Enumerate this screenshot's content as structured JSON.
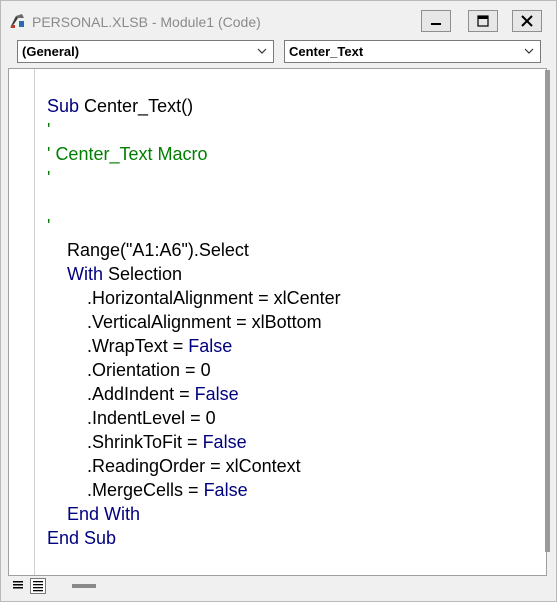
{
  "window": {
    "title": "PERSONAL.XLSB - Module1 (Code)",
    "icons": {
      "app": "vba-module-icon",
      "minimize": "minimize-icon",
      "maximize": "maximize-icon",
      "close": "close-icon"
    }
  },
  "object_combo": {
    "value": "(General)"
  },
  "procedure_combo": {
    "value": "Center_Text"
  },
  "code": {
    "keyword_color": "#00007f",
    "comment_color": "#007f00",
    "lines": [
      [
        {
          "t": "Sub ",
          "c": "kw"
        },
        {
          "t": "Center_Text()"
        }
      ],
      [
        {
          "t": "'",
          "c": "cm"
        }
      ],
      [
        {
          "t": "' Center_Text Macro",
          "c": "cm"
        }
      ],
      [
        {
          "t": "'",
          "c": "cm"
        }
      ],
      [],
      [
        {
          "t": "'",
          "c": "cm"
        }
      ],
      [
        {
          "t": "    Range(\"A1:A6\").Select"
        }
      ],
      [
        {
          "t": "    "
        },
        {
          "t": "With",
          "c": "kw"
        },
        {
          "t": " Selection"
        }
      ],
      [
        {
          "t": "        .HorizontalAlignment = xlCenter"
        }
      ],
      [
        {
          "t": "        .VerticalAlignment = xlBottom"
        }
      ],
      [
        {
          "t": "        .WrapText = "
        },
        {
          "t": "False",
          "c": "kw"
        }
      ],
      [
        {
          "t": "        .Orientation = 0"
        }
      ],
      [
        {
          "t": "        .AddIndent = "
        },
        {
          "t": "False",
          "c": "kw"
        }
      ],
      [
        {
          "t": "        .IndentLevel = 0"
        }
      ],
      [
        {
          "t": "        .ShrinkToFit = "
        },
        {
          "t": "False",
          "c": "kw"
        }
      ],
      [
        {
          "t": "        .ReadingOrder = xlContext"
        }
      ],
      [
        {
          "t": "        .MergeCells = "
        },
        {
          "t": "False",
          "c": "kw"
        }
      ],
      [
        {
          "t": "    "
        },
        {
          "t": "End With",
          "c": "kw"
        }
      ],
      [
        {
          "t": "End Sub",
          "c": "kw"
        }
      ]
    ]
  },
  "status": {
    "procedure_view_icon": "procedure-view-icon",
    "full_module_view_icon": "full-module-view-icon"
  }
}
